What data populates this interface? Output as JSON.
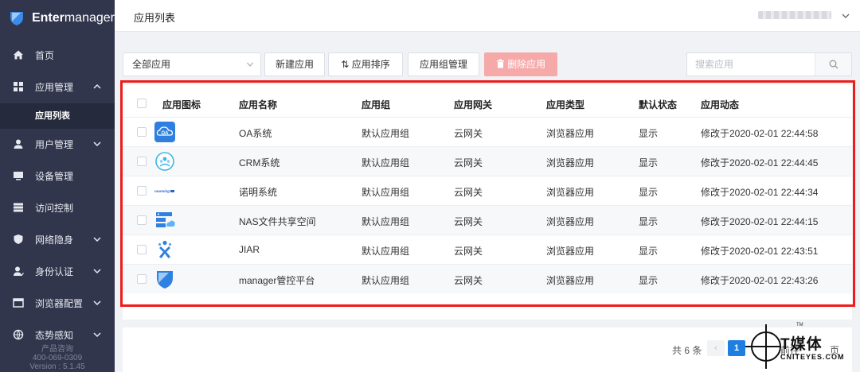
{
  "brand": {
    "name_bold": "Enter",
    "name_light": "manager"
  },
  "sidebar": {
    "items": [
      {
        "label": "首页",
        "icon": "home-icon"
      },
      {
        "label": "应用管理",
        "icon": "grid-icon",
        "expanded": true
      },
      {
        "label": "用户管理",
        "icon": "user-icon"
      },
      {
        "label": "设备管理",
        "icon": "monitor-icon"
      },
      {
        "label": "访问控制",
        "icon": "server-icon"
      },
      {
        "label": "网络隐身",
        "icon": "shield-icon"
      },
      {
        "label": "身份认证",
        "icon": "user-check-icon"
      },
      {
        "label": "浏览器配置",
        "icon": "browser-icon"
      },
      {
        "label": "态势感知",
        "icon": "globe-icon"
      }
    ],
    "active_sub": "应用列表",
    "footer": {
      "line1": "产品咨询",
      "line2": "400-069-0309",
      "line3": "Version : 5.1.45"
    }
  },
  "header": {
    "title": "应用列表"
  },
  "toolbar": {
    "filter_value": "全部应用",
    "new_app": "新建应用",
    "sort_app": "应用排序",
    "group_mgmt": "应用组管理",
    "delete_app": "删除应用",
    "search_placeholder": "搜索应用"
  },
  "table": {
    "columns": [
      "应用图标",
      "应用名称",
      "应用组",
      "应用网关",
      "应用类型",
      "默认状态",
      "应用动态"
    ],
    "rows": [
      {
        "icon": "oa-icon",
        "name": "OA系统",
        "group": "默认应用组",
        "gateway": "云网关",
        "type": "浏览器应用",
        "status": "显示",
        "activity": "修改于2020-02-01 22:44:58"
      },
      {
        "icon": "crm-icon",
        "name": "CRM系统",
        "group": "默认应用组",
        "gateway": "云网关",
        "type": "浏览器应用",
        "status": "显示",
        "activity": "修改于2020-02-01 22:44:45"
      },
      {
        "icon": "nuoming-icon",
        "icon_text": "nuoming",
        "name": "诺明系统",
        "group": "默认应用组",
        "gateway": "云网关",
        "type": "浏览器应用",
        "status": "显示",
        "activity": "修改于2020-02-01 22:44:34"
      },
      {
        "icon": "nas-icon",
        "name": "NAS文件共享空间",
        "group": "默认应用组",
        "gateway": "云网关",
        "type": "浏览器应用",
        "status": "显示",
        "activity": "修改于2020-02-01 22:44:15"
      },
      {
        "icon": "jira-icon",
        "name": "JIAR",
        "group": "默认应用组",
        "gateway": "云网关",
        "type": "浏览器应用",
        "status": "显示",
        "activity": "修改于2020-02-01 22:43:51"
      },
      {
        "icon": "manager-icon",
        "name": "manager管控平台",
        "group": "默认应用组",
        "gateway": "云网关",
        "type": "浏览器应用",
        "status": "显示",
        "activity": "修改于2020-02-01 22:43:26"
      }
    ]
  },
  "pagination": {
    "total": "共 6 条",
    "current": "1",
    "goto": "前往",
    "unit": "页"
  },
  "watermark": {
    "cn": "T媒体",
    "en": "CNITEYES.COM",
    "tm": "TM"
  },
  "colors": {
    "sidebar": "#32364d",
    "primary": "#1e7fe0",
    "delete": "#f6a9a9",
    "highlight": "#ee1c1c"
  }
}
